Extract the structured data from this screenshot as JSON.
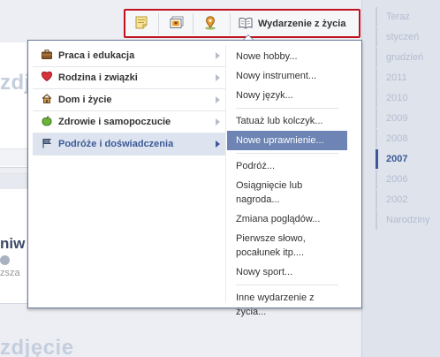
{
  "background": {
    "heading_top": "zdję",
    "heading_bottom": "zdjęcie",
    "name_fragment": "niw",
    "small_text": "zsza"
  },
  "composer": {
    "buttons": [
      {
        "icon": "status-note-icon"
      },
      {
        "icon": "photo-icon"
      },
      {
        "icon": "place-pin-icon"
      },
      {
        "icon": "life-event-book-icon",
        "label": "Wydarzenie z życia"
      }
    ],
    "highlight_color": "#c0121e"
  },
  "menu": {
    "categories": [
      {
        "label": "Praca i edukacja",
        "icon": "briefcase-icon"
      },
      {
        "label": "Rodzina i związki",
        "icon": "heart-icon"
      },
      {
        "label": "Dom i życie",
        "icon": "house-icon"
      },
      {
        "label": "Zdrowie i samopoczucie",
        "icon": "apple-icon"
      },
      {
        "label": "Podróże i doświadczenia",
        "icon": "flag-icon",
        "selected": true
      }
    ],
    "items": [
      "Nowe hobby...",
      "Nowy instrument...",
      "Nowy język...",
      "Tatuaż lub kolczyk...",
      "Nowe uprawnienie...",
      "Podróż...",
      "Osiągnięcie lub nagroda...",
      "Zmiana poglądów...",
      "Pierwsze słowo, pocałunek itp....",
      "Nowy sport...",
      "Inne wydarzenie z życia..."
    ],
    "selected_item": "Nowe uprawnienie...",
    "accent_color": "#6d84b4"
  },
  "timeline_nav": {
    "items": [
      "Teraz",
      "styczeń",
      "grudzień",
      "2011",
      "2010",
      "2009",
      "2008",
      "2007",
      "2006",
      "2002",
      "Narodziny"
    ],
    "active": "2007"
  }
}
